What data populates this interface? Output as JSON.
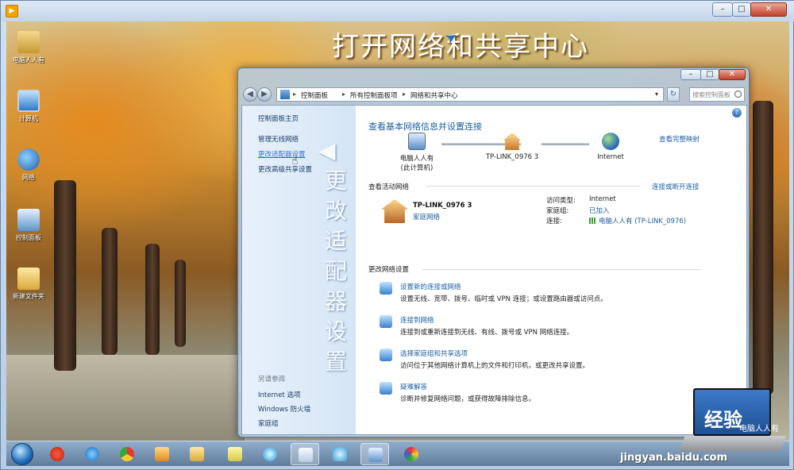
{
  "outer": {
    "title_buttons": {
      "minimize": "–",
      "maximize": "□",
      "close": "✕"
    }
  },
  "banner": "打开网络和共享中心",
  "desktop_icons": [
    {
      "label": "电脑人人有"
    },
    {
      "label": "计算机"
    },
    {
      "label": "网络"
    },
    {
      "label": "控制面板"
    },
    {
      "label": "新建文件夹"
    }
  ],
  "window": {
    "buttons": {
      "minimize": "–",
      "maximize": "□",
      "close": "✕"
    },
    "nav": {
      "back": "◀",
      "forward": "▶",
      "refresh": "↻",
      "dropdown": "▾"
    },
    "breadcrumbs": [
      "控制面板",
      "所有控制面板项",
      "网络和共享中心"
    ],
    "crumb_sep": "▸",
    "search_placeholder": "搜索控制面板"
  },
  "sidebar": {
    "home": "控制面板主页",
    "items": [
      "管理无线网络",
      "更改适配器设置",
      "更改高级共享设置"
    ],
    "see_also_header": "另请参阅",
    "see_also": [
      "Internet 选项",
      "Windows 防火墙",
      "家庭组"
    ],
    "annotation": "更改适配器设置",
    "annotation_arrow": "◀"
  },
  "main": {
    "help": "?",
    "title": "查看基本网络信息并设置连接",
    "see_full_map": "查看完整映射",
    "map": {
      "pc_line1": "电脑人人有",
      "pc_line2": "(此计算机)",
      "router": "TP-LINK_0976  3",
      "internet": "Internet"
    },
    "active_header": "查看活动网络",
    "connect_disconnect": "连接或断开连接",
    "active_network": {
      "name": "TP-LINK_0976  3",
      "type": "家庭网络",
      "access_type_label": "访问类型:",
      "access_type_value": "Internet",
      "homegroup_label": "家庭组:",
      "homegroup_value": "已加入",
      "connection_label": "连接:",
      "connection_value": "电脑人人有 (TP-LINK_0976)"
    },
    "change_header": "更改网络设置",
    "tasks": [
      {
        "title": "设置新的连接或网络",
        "desc": "设置无线、宽带、拨号、临时或 VPN 连接；或设置路由器或访问点。"
      },
      {
        "title": "连接到网络",
        "desc": "连接到或重新连接到无线、有线、拨号或 VPN 网络连接。"
      },
      {
        "title": "选择家庭组和共享选项",
        "desc": "访问位于其他网络计算机上的文件和打印机，或更改共享设置。"
      },
      {
        "title": "疑难解答",
        "desc": "诊断并修复网络问题，或获得故障排除信息。"
      }
    ]
  },
  "taskbar": {
    "items": [
      "将",
      "IE",
      "Chrome",
      "媒体",
      "资源管理器",
      "便笺",
      "360",
      "Word",
      "网络",
      "控制面板",
      "画图"
    ]
  },
  "watermark": {
    "baidu": "Baidu",
    "jingyan": "经验",
    "url": "jingyan.baidu.com",
    "laptop_text": "电脑人人有"
  },
  "colors": {
    "link": "#1e5fa3",
    "sidebar_bg": "#dbe8f6",
    "close_button": "#c2412b"
  }
}
